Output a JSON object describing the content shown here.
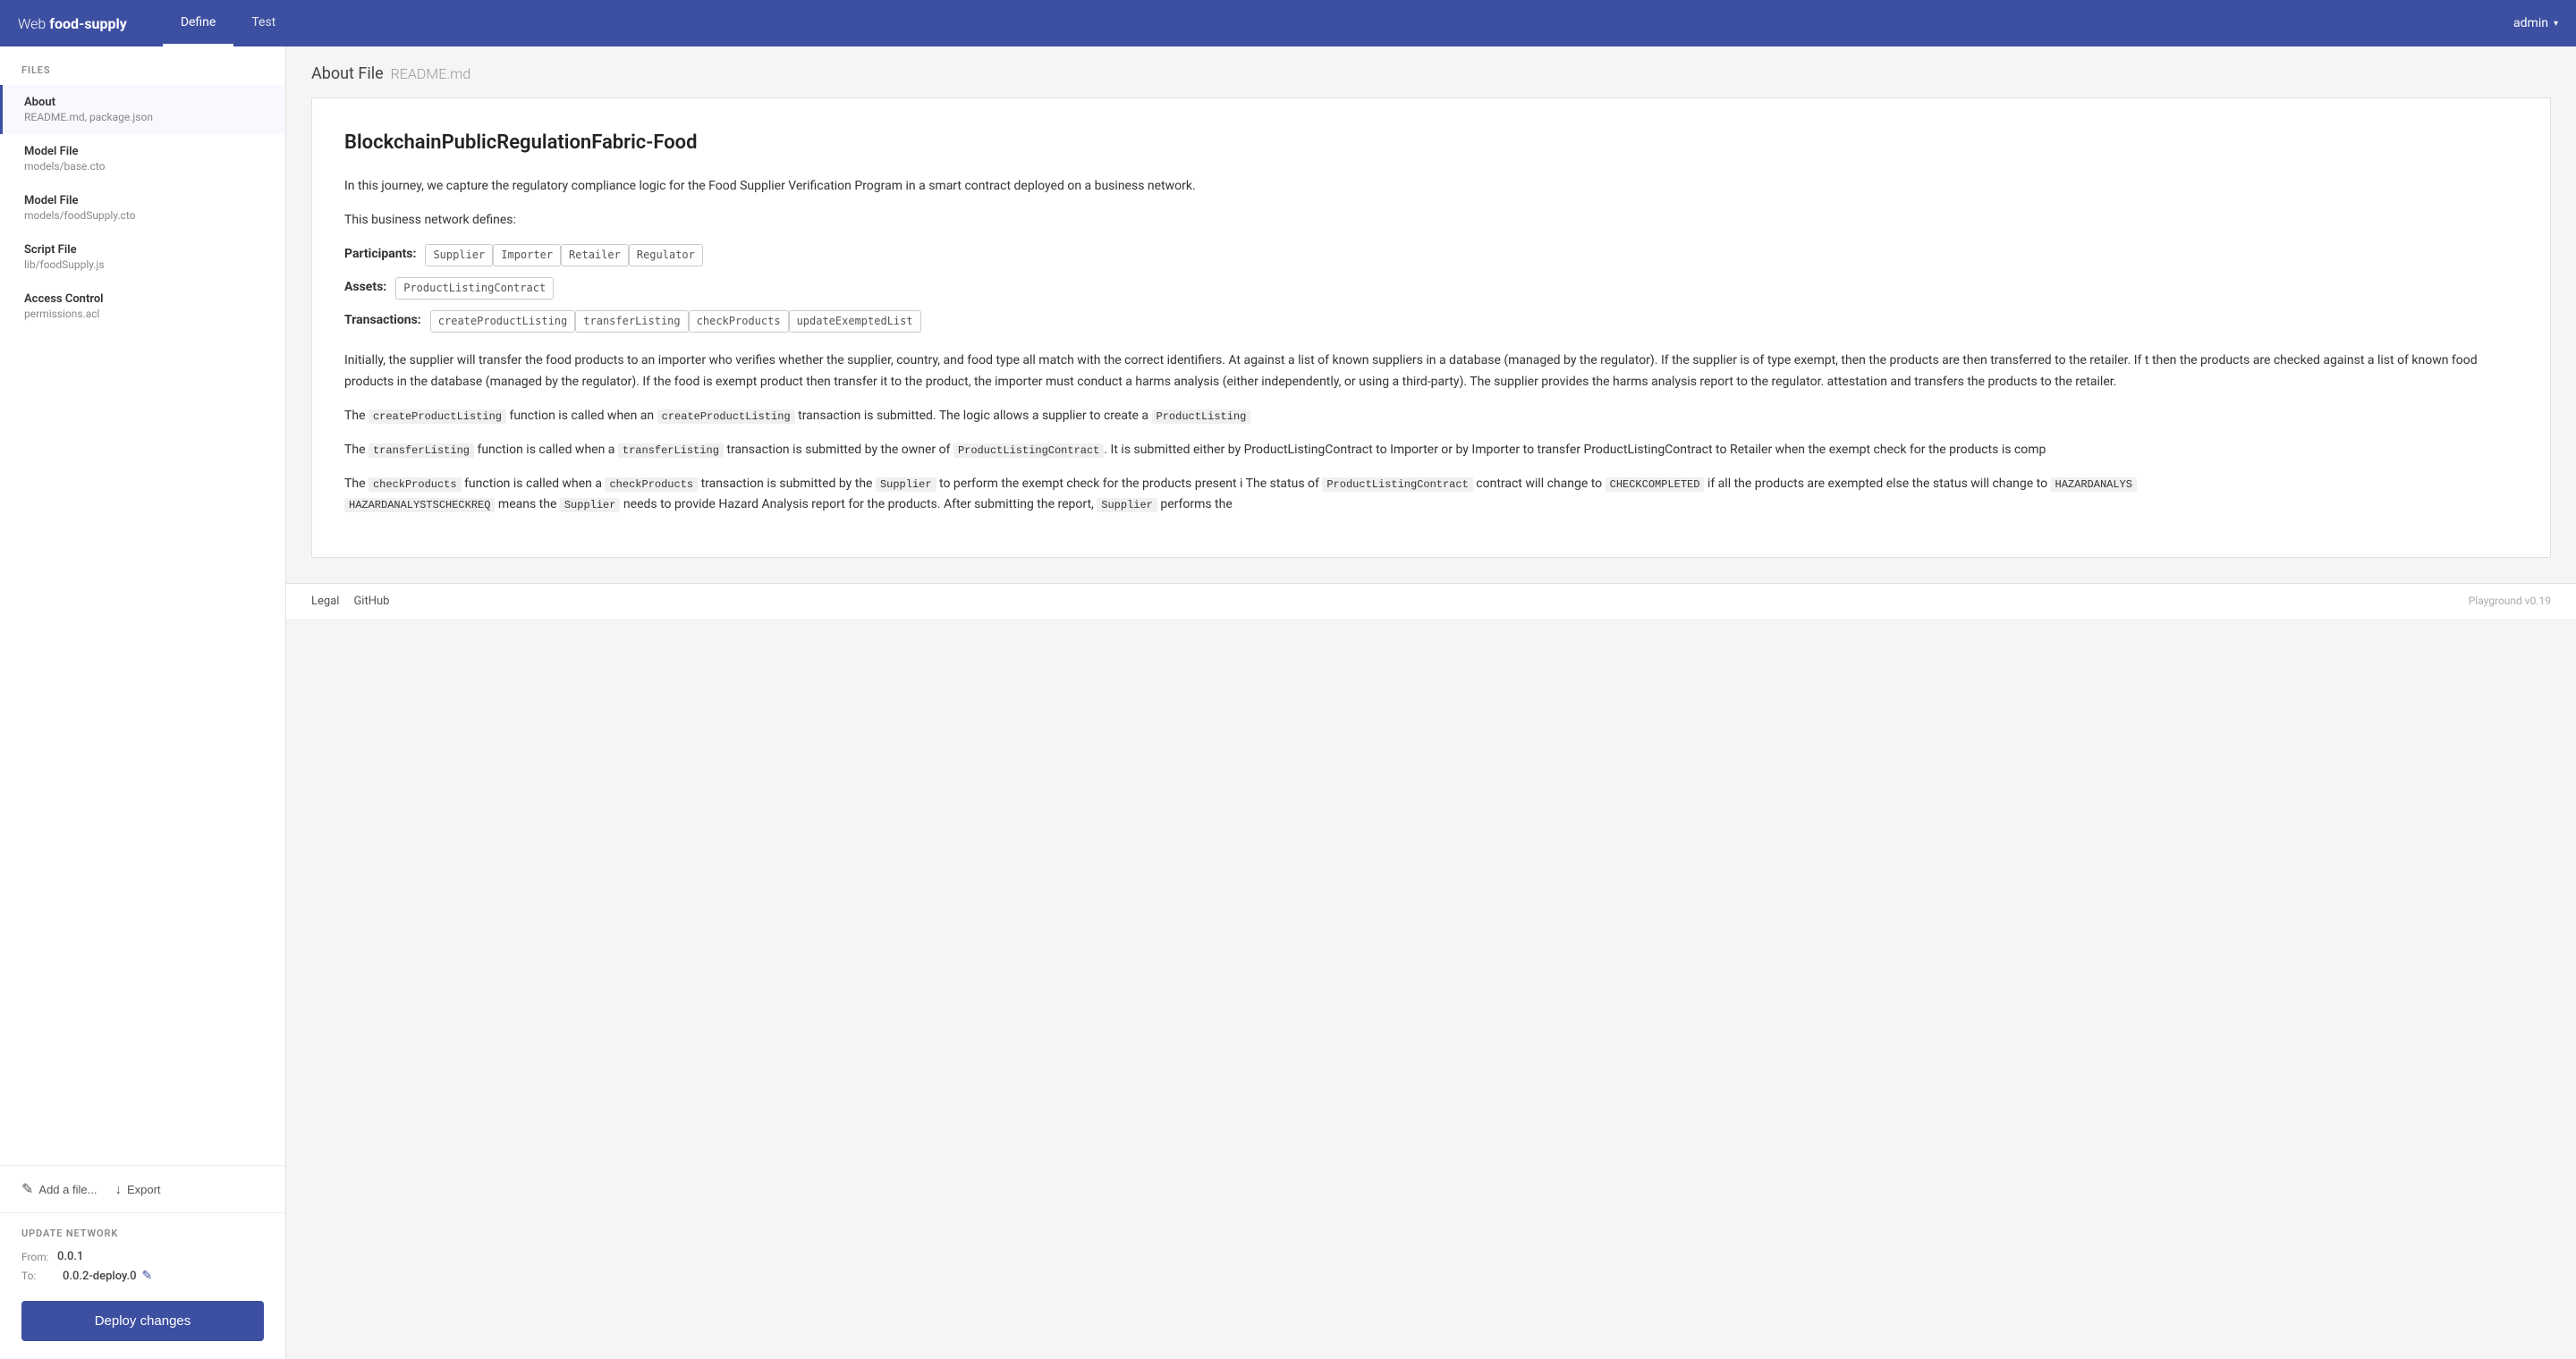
{
  "app": {
    "brand_web": "Web",
    "brand_name": "food-supply",
    "admin_label": "admin",
    "chevron": "▾"
  },
  "nav": {
    "tabs": [
      {
        "id": "define",
        "label": "Define",
        "active": true
      },
      {
        "id": "test",
        "label": "Test",
        "active": false
      }
    ]
  },
  "sidebar": {
    "files_title": "FILES",
    "items": [
      {
        "id": "about",
        "title": "About",
        "subtitle": "README.md, package.json",
        "active": true
      },
      {
        "id": "model-base",
        "title": "Model File",
        "subtitle": "models/base.cto",
        "active": false
      },
      {
        "id": "model-food",
        "title": "Model File",
        "subtitle": "models/foodSupply.cto",
        "active": false
      },
      {
        "id": "script-file",
        "title": "Script File",
        "subtitle": "lib/foodSupply.js",
        "active": false
      },
      {
        "id": "access-control",
        "title": "Access Control",
        "subtitle": "permissions.acl",
        "active": false
      }
    ],
    "add_file_label": "Add a file...",
    "export_label": "Export",
    "update_title": "UPDATE NETWORK",
    "from_label": "From:",
    "from_value": "0.0.1",
    "to_label": "To:",
    "to_value": "0.0.2-deploy.0",
    "deploy_label": "Deploy changes"
  },
  "content": {
    "header_title": "About File",
    "header_filename": "README.md",
    "doc_title": "BlockchainPublicRegulationFabric-Food",
    "paragraph1": "In this journey, we capture the regulatory compliance logic for the Food Supplier Verification Program in a smart contract deployed on a business network.",
    "paragraph2": "This business network defines:",
    "participants_label": "Participants:",
    "participants": [
      "Supplier",
      "Importer",
      "Retailer",
      "Regulator"
    ],
    "assets_label": "Assets:",
    "assets": [
      "ProductListingContract"
    ],
    "transactions_label": "Transactions:",
    "transactions": [
      "createProductListing",
      "transferListing",
      "checkProducts",
      "updateExemptedList"
    ],
    "paragraph3": "Initially, the supplier will transfer the food products to an importer who verifies whether the supplier, country, and food type all match with the correct identifiers. At against a list of known suppliers in a database (managed by the regulator). If the supplier is of type exempt, then the products are then transferred to the retailer. If t then the products are checked against a list of known food products in the database (managed by the regulator). If the food is exempt product then transfer it to the product, the importer must conduct a harms analysis (either independently, or using a third-party). The supplier provides the harms analysis report to the regulator. attestation and transfers the products to the retailer.",
    "paragraph4_prefix": "The",
    "paragraph4_func": "createProductListing",
    "paragraph4_middle": "function is called when an",
    "paragraph4_trans": "createProductListing",
    "paragraph4_suffix": "transaction is submitted. The logic allows a supplier to create a",
    "paragraph4_end": "ProductListing",
    "paragraph5_prefix": "The",
    "paragraph5_func": "transferListing",
    "paragraph5_middle": "function is called when a",
    "paragraph5_trans": "transferListing",
    "paragraph5_suffix": "transaction is submitted by the owner of",
    "paragraph5_contract": "ProductListingContract",
    "paragraph5_rest": ". It is submitted either by ProductListingContract to Importer or by Importer to transfer ProductListingContract to Retailer when the exempt check for the products is comp",
    "paragraph6_prefix": "The",
    "paragraph6_func": "checkProducts",
    "paragraph6_middle": "function is called when a",
    "paragraph6_trans": "checkProducts",
    "paragraph6_suffix": "transaction is submitted by the",
    "paragraph6_who": "Supplier",
    "paragraph6_rest": "to perform the exempt check for the products present i The status of",
    "paragraph6_contract": "ProductListingContract",
    "paragraph6_rest2": "contract will change to",
    "paragraph6_status1": "CHECKCOMPLETED",
    "paragraph6_rest3": "if all the products are exempted else the status will change to",
    "paragraph6_status2": "HAZARDANALYS",
    "paragraph6_status3": "HAZARDANALYSTSCHECKREQ",
    "paragraph6_rest4": "means the",
    "paragraph6_who2": "Supplier",
    "paragraph6_rest5": "needs to provide Hazard Analysis report for the products. After submitting the report,",
    "paragraph6_who3": "Supplier",
    "paragraph6_rest6": "performs the",
    "footer": {
      "legal": "Legal",
      "github": "GitHub",
      "version": "Playground v0.19"
    }
  }
}
